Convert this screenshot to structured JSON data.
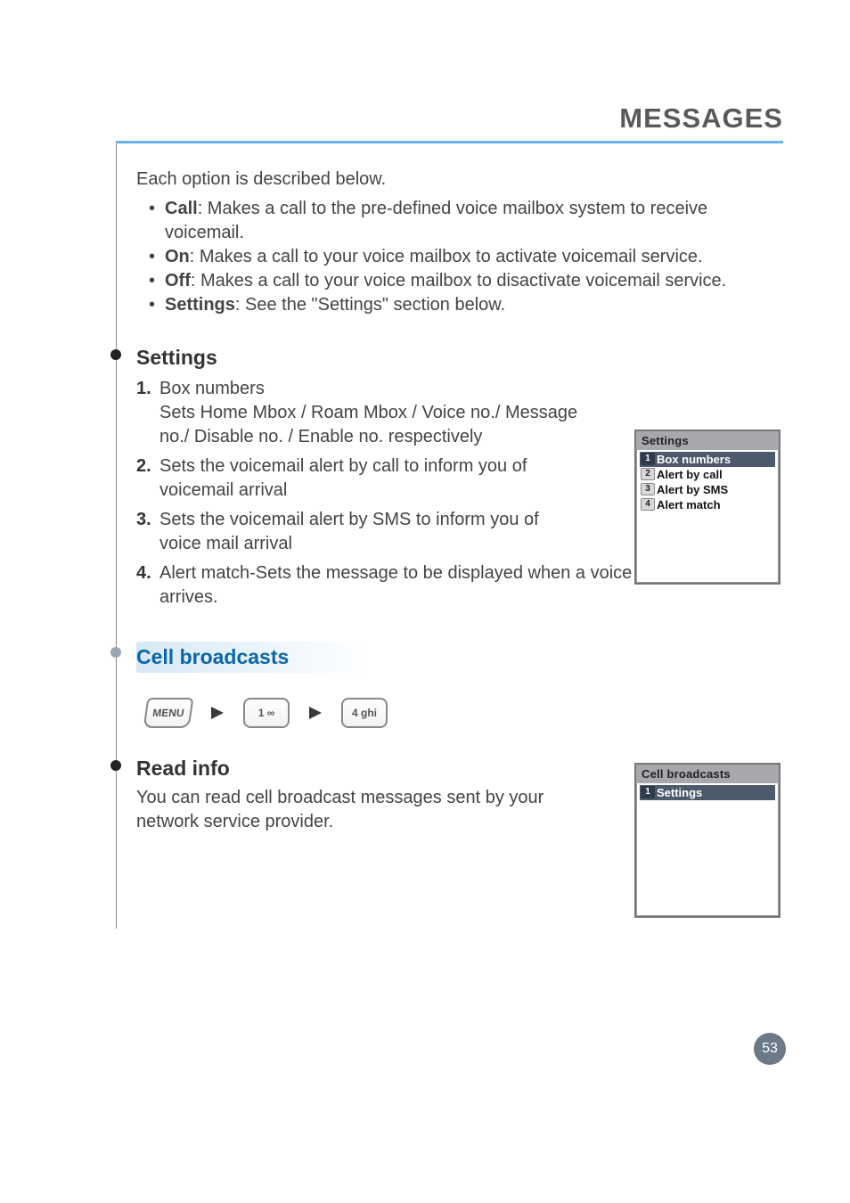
{
  "header": {
    "title": "MESSAGES"
  },
  "intro": "Each option is described below.",
  "bullets": [
    {
      "label": "Call",
      "text": ": Makes a call to the pre-defined voice mailbox system to receive voicemail."
    },
    {
      "label": "On",
      "text": ": Makes a call to your voice mailbox to activate voicemail service."
    },
    {
      "label": "Off",
      "text": ": Makes a call to your voice mailbox to disactivate voicemail service."
    },
    {
      "label": "Settings",
      "text": ": See the \"Settings\" section below."
    }
  ],
  "settings": {
    "heading": "Settings",
    "items": [
      "Box numbers\nSets Home Mbox / Roam Mbox / Voice no./ Message no./ Disable no. / Enable no. respectively",
      "Sets the voicemail alert by call to inform you of voicemail arrival",
      "Sets the voicemail alert by SMS to inform you of voice mail arrival",
      "Alert match-Sets the message to be displayed when a voice mail arrives."
    ]
  },
  "cell_broadcasts": {
    "heading": "Cell broadcasts",
    "keys": [
      "MENU",
      "1 ∞",
      "4 ghi"
    ]
  },
  "read_info": {
    "heading": "Read info",
    "body": "You can read cell broadcast messages sent by your network service provider."
  },
  "phone_settings": {
    "title": "Settings",
    "items": [
      {
        "idx": "1",
        "label": "Box numbers",
        "selected": true
      },
      {
        "idx": "2",
        "label": "Alert by call",
        "selected": false
      },
      {
        "idx": "3",
        "label": "Alert by SMS",
        "selected": false
      },
      {
        "idx": "4",
        "label": "Alert match",
        "selected": false
      }
    ]
  },
  "phone_cb": {
    "title": "Cell broadcasts",
    "items": [
      {
        "idx": "1",
        "label": "Settings",
        "selected": true
      }
    ]
  },
  "page_number": "53"
}
